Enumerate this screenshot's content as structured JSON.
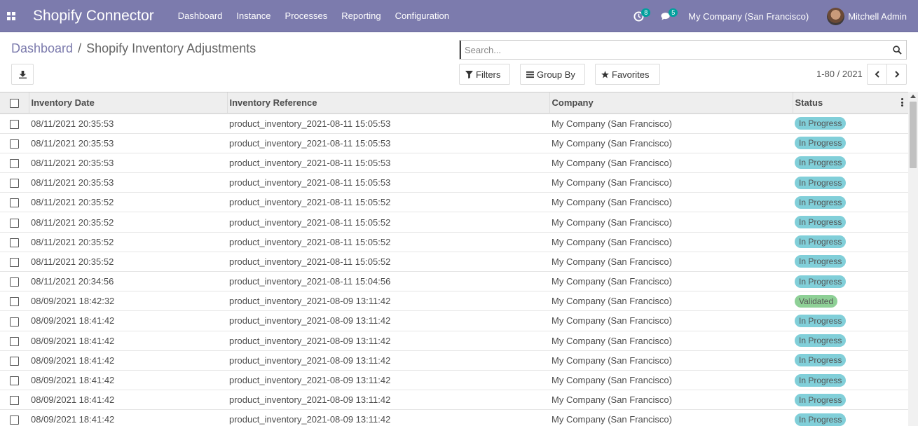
{
  "navbar": {
    "app_title": "Shopify Connector",
    "menu": [
      "Dashboard",
      "Instance",
      "Processes",
      "Reporting",
      "Configuration"
    ],
    "activity_count": "8",
    "messages_count": "5",
    "company": "My Company (San Francisco)",
    "user_name": "Mitchell Admin",
    "color": "#7c7bad"
  },
  "breadcrumb": {
    "parent": "Dashboard",
    "separator": "/",
    "current": "Shopify Inventory Adjustments"
  },
  "search": {
    "placeholder": "Search..."
  },
  "filters": {
    "filters_label": "Filters",
    "group_by_label": "Group By",
    "favorites_label": "Favorites"
  },
  "pager": {
    "value": "1-80 / 2021"
  },
  "table": {
    "columns": [
      "Inventory Date",
      "Inventory Reference",
      "Company",
      "Status"
    ],
    "status_colors": {
      "In Progress": "#81cfd9",
      "Validated": "#8ed096"
    },
    "rows": [
      {
        "date": "08/11/2021 20:35:53",
        "ref": "product_inventory_2021-08-11 15:05:53",
        "company": "My Company (San Francisco)",
        "status": "In Progress"
      },
      {
        "date": "08/11/2021 20:35:53",
        "ref": "product_inventory_2021-08-11 15:05:53",
        "company": "My Company (San Francisco)",
        "status": "In Progress"
      },
      {
        "date": "08/11/2021 20:35:53",
        "ref": "product_inventory_2021-08-11 15:05:53",
        "company": "My Company (San Francisco)",
        "status": "In Progress"
      },
      {
        "date": "08/11/2021 20:35:53",
        "ref": "product_inventory_2021-08-11 15:05:53",
        "company": "My Company (San Francisco)",
        "status": "In Progress"
      },
      {
        "date": "08/11/2021 20:35:52",
        "ref": "product_inventory_2021-08-11 15:05:52",
        "company": "My Company (San Francisco)",
        "status": "In Progress"
      },
      {
        "date": "08/11/2021 20:35:52",
        "ref": "product_inventory_2021-08-11 15:05:52",
        "company": "My Company (San Francisco)",
        "status": "In Progress"
      },
      {
        "date": "08/11/2021 20:35:52",
        "ref": "product_inventory_2021-08-11 15:05:52",
        "company": "My Company (San Francisco)",
        "status": "In Progress"
      },
      {
        "date": "08/11/2021 20:35:52",
        "ref": "product_inventory_2021-08-11 15:05:52",
        "company": "My Company (San Francisco)",
        "status": "In Progress"
      },
      {
        "date": "08/11/2021 20:34:56",
        "ref": "product_inventory_2021-08-11 15:04:56",
        "company": "My Company (San Francisco)",
        "status": "In Progress"
      },
      {
        "date": "08/09/2021 18:42:32",
        "ref": "product_inventory_2021-08-09 13:11:42",
        "company": "My Company (San Francisco)",
        "status": "Validated"
      },
      {
        "date": "08/09/2021 18:41:42",
        "ref": "product_inventory_2021-08-09 13:11:42",
        "company": "My Company (San Francisco)",
        "status": "In Progress"
      },
      {
        "date": "08/09/2021 18:41:42",
        "ref": "product_inventory_2021-08-09 13:11:42",
        "company": "My Company (San Francisco)",
        "status": "In Progress"
      },
      {
        "date": "08/09/2021 18:41:42",
        "ref": "product_inventory_2021-08-09 13:11:42",
        "company": "My Company (San Francisco)",
        "status": "In Progress"
      },
      {
        "date": "08/09/2021 18:41:42",
        "ref": "product_inventory_2021-08-09 13:11:42",
        "company": "My Company (San Francisco)",
        "status": "In Progress"
      },
      {
        "date": "08/09/2021 18:41:42",
        "ref": "product_inventory_2021-08-09 13:11:42",
        "company": "My Company (San Francisco)",
        "status": "In Progress"
      },
      {
        "date": "08/09/2021 18:41:42",
        "ref": "product_inventory_2021-08-09 13:11:42",
        "company": "My Company (San Francisco)",
        "status": "In Progress"
      }
    ]
  }
}
